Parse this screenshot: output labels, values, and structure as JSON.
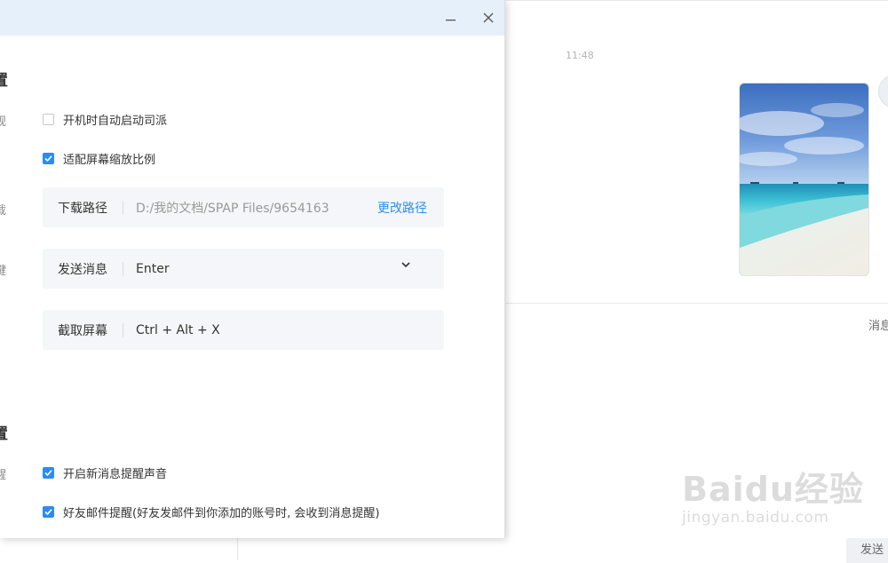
{
  "chat": {
    "time": "11:48",
    "side_label": "消息",
    "send_label": "发送"
  },
  "watermark": {
    "logo": "Baidu经验",
    "url": "jingyan.baidu.com"
  },
  "settings": {
    "section1": {
      "title": "置",
      "startup_label": "规",
      "auto_start": {
        "label": "开机时自动启动司派",
        "checked": false
      },
      "fit_scale": {
        "label": "适配屏幕缩放比例",
        "checked": true
      },
      "download_label": "载",
      "download_path": {
        "label": "下载路径",
        "value": "D:/我的文档/SPAP Files/9654163",
        "link": "更改路径"
      },
      "hotkey_label": "键",
      "send_message": {
        "label": "发送消息",
        "value": "Enter"
      },
      "screenshot": {
        "label": "截取屏幕",
        "value": "Ctrl + Alt + X"
      }
    },
    "section2": {
      "title": "置",
      "notify_label": "醒",
      "sound": {
        "label": "开启新消息提醒声音",
        "checked": true
      },
      "mail": {
        "label": "好友邮件提醒(好友发邮件到你添加的账号时, 会收到消息提醒)",
        "checked": true
      }
    }
  },
  "colors": {
    "accent": "#2d8cf0",
    "titlebar": "#e6f0fb",
    "field_bg": "#f4f6f9"
  }
}
